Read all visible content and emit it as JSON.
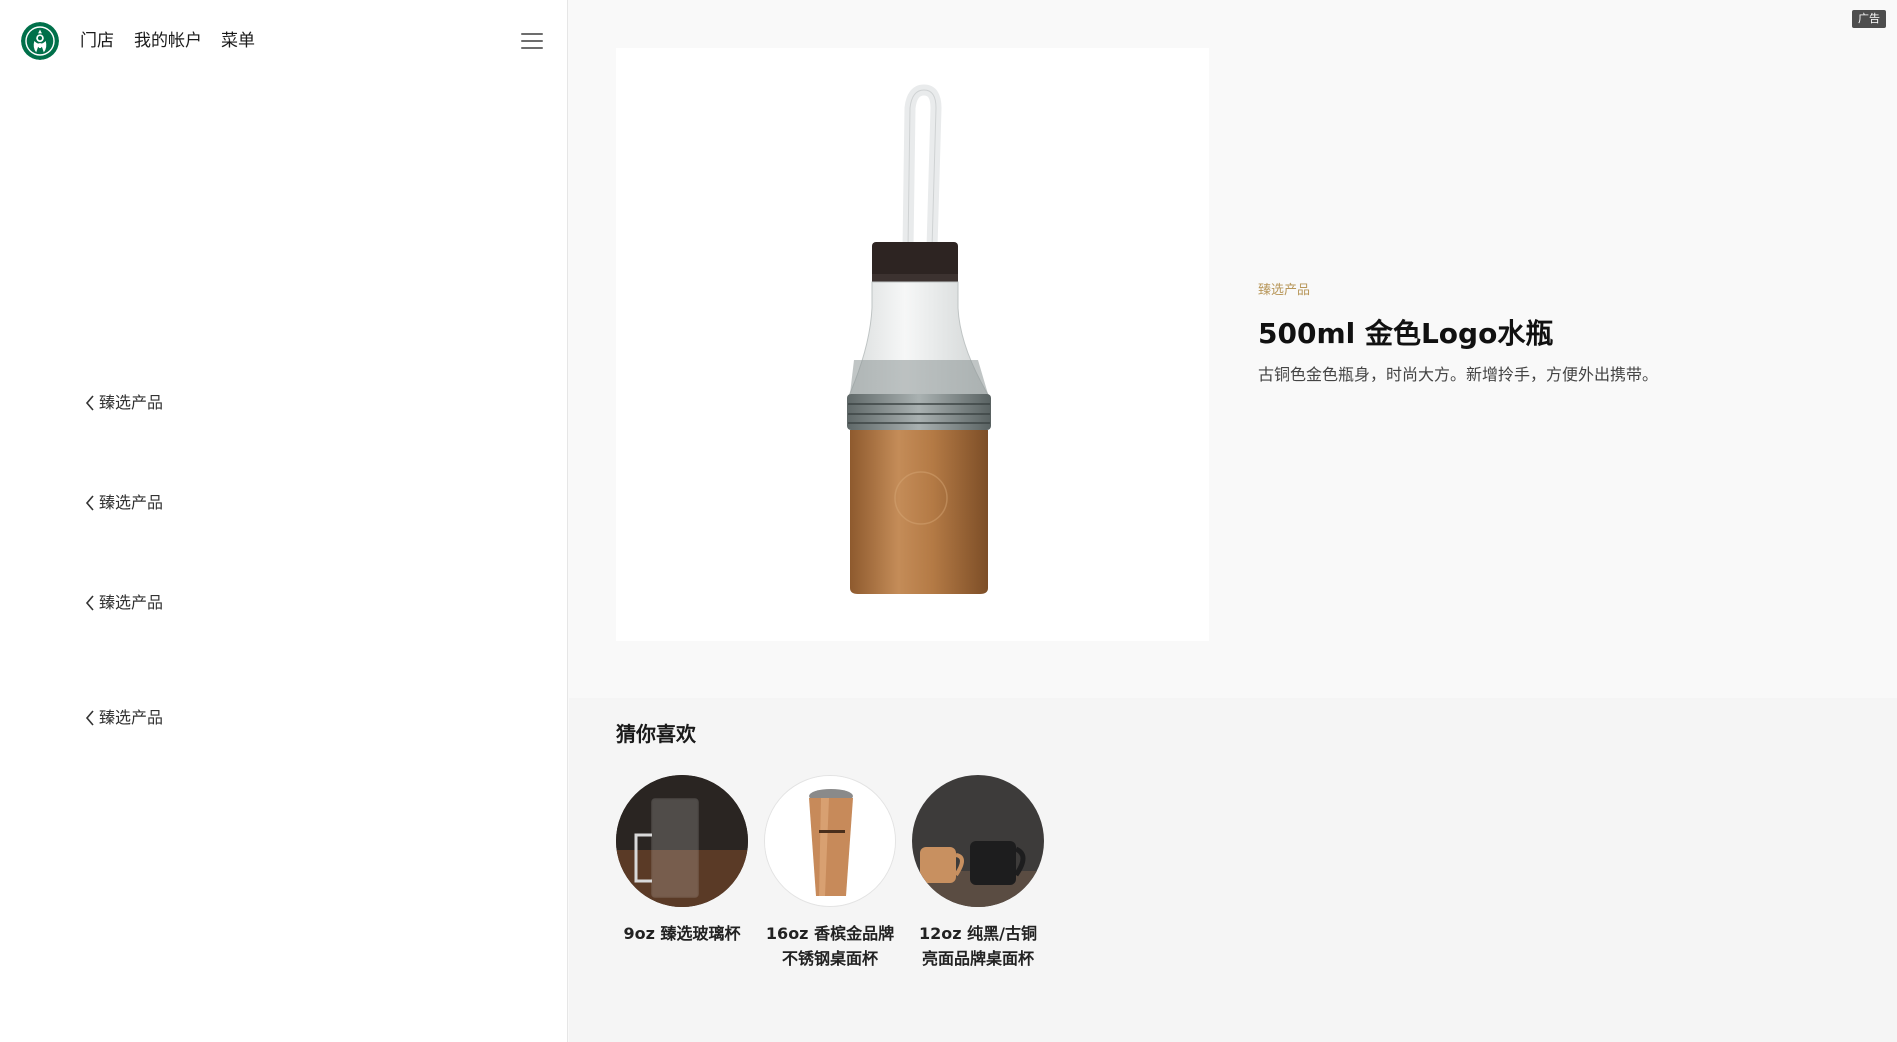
{
  "header": {
    "logo_icon": "starbucks-siren-logo",
    "nav": [
      "门店",
      "我的帐户",
      "菜单"
    ],
    "menu_icon": "hamburger-menu-icon"
  },
  "sidebar": {
    "links": [
      "臻选产品",
      "臻选产品",
      "臻选产品",
      "臻选产品"
    ]
  },
  "ad_badge": "广告",
  "product": {
    "category": "臻选产品",
    "title": "500ml 金色Logo水瓶",
    "description": "古铜色金色瓶身，时尚大方。新增拎手，方便外出携带。"
  },
  "recommendations": {
    "title": "猜你喜欢",
    "items": [
      {
        "line1": "9oz 臻选玻璃杯",
        "line2": ""
      },
      {
        "line1": "16oz 香槟金品牌",
        "line2": "不锈钢桌面杯"
      },
      {
        "line1": "12oz 纯黑/古铜",
        "line2": "亮面品牌桌面杯"
      }
    ]
  },
  "colors": {
    "accent_gold": "#b8975a",
    "brand_green": "#00704a",
    "bottle_copper": "#b8824f"
  }
}
